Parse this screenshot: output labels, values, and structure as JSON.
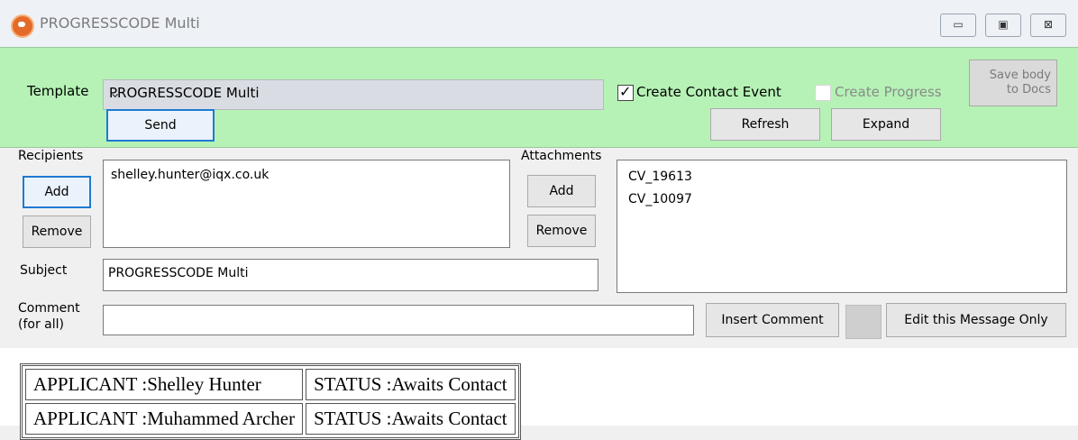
{
  "window": {
    "title": "PROGRESSCODE Multi",
    "min_glyph": "▭",
    "max_glyph": "▣",
    "close_glyph": "⊠"
  },
  "template": {
    "label": "Template",
    "value": "PROGRESSCODE Multi"
  },
  "options": {
    "create_contact_event": "Create Contact Event",
    "create_progress": "Create Progress",
    "save_body": "Save body\nto Docs"
  },
  "actions": {
    "send": "Send",
    "refresh": "Refresh",
    "expand": "Expand"
  },
  "recipients": {
    "label": "Recipients",
    "add": "Add",
    "remove": "Remove",
    "items": [
      "shelley.hunter@iqx.co.uk"
    ]
  },
  "attachments": {
    "label": "Attachments",
    "add": "Add",
    "remove": "Remove",
    "items": [
      "CV_19613",
      "CV_10097"
    ]
  },
  "subject": {
    "label": "Subject",
    "value": "PROGRESSCODE Multi"
  },
  "comment": {
    "label": "Comment\n(for all)",
    "value": "",
    "insert": "Insert Comment",
    "edit_only": "Edit this Message Only"
  },
  "message_table": [
    {
      "applicant": "APPLICANT :Shelley Hunter",
      "status": "STATUS :Awaits Contact"
    },
    {
      "applicant": "APPLICANT :Muhammed Archer",
      "status": "STATUS :Awaits Contact"
    }
  ]
}
